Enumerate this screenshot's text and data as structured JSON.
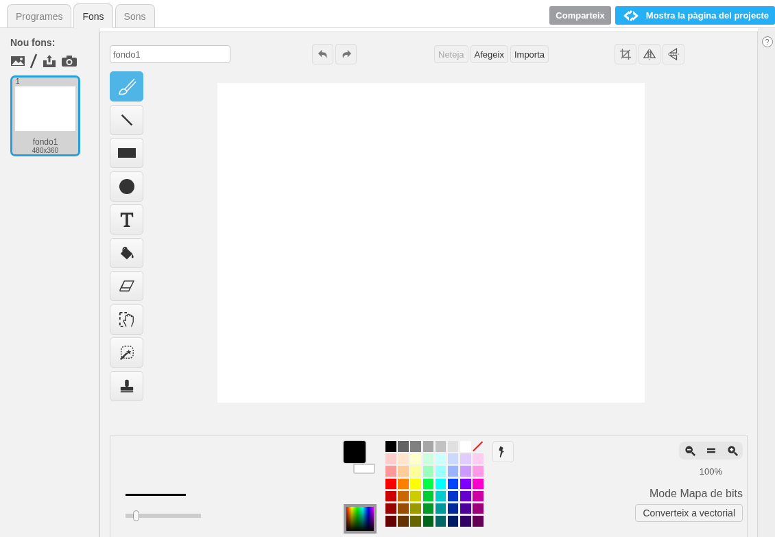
{
  "tabs": [
    {
      "label": "Programes",
      "selected": false
    },
    {
      "label": "Fons",
      "selected": true
    },
    {
      "label": "Sons",
      "selected": false
    }
  ],
  "header_buttons": [
    {
      "label": "Comparteix",
      "kind": "plain"
    },
    {
      "label": "Mostra la pàgina del projecte",
      "kind": "project"
    }
  ],
  "sidebar": {
    "title": "Nou fons:",
    "new_actions": [
      {
        "kind": "library"
      },
      {
        "kind": "paint"
      },
      {
        "kind": "upload"
      },
      {
        "kind": "camera"
      }
    ],
    "backdrops": [
      {
        "index": "1",
        "name": "fondo1",
        "size": "480x360",
        "selected": true
      }
    ]
  },
  "editor": {
    "name_value": "fondo1",
    "history": [
      {
        "kind": "undo"
      },
      {
        "kind": "redo"
      }
    ],
    "actions": [
      {
        "label": "Neteja",
        "disabled": true
      },
      {
        "label": "Afegeix",
        "disabled": false
      },
      {
        "label": "Importa",
        "disabled": false
      }
    ],
    "transforms": [
      {
        "kind": "crop"
      },
      {
        "kind": "flip-h"
      },
      {
        "kind": "flip-v"
      }
    ],
    "tools": [
      {
        "kind": "brush",
        "selected": true
      },
      {
        "kind": "line",
        "selected": false
      },
      {
        "kind": "rect",
        "selected": false
      },
      {
        "kind": "ellipse",
        "selected": false
      },
      {
        "kind": "text",
        "selected": false
      },
      {
        "kind": "fill",
        "selected": false
      },
      {
        "kind": "eraser",
        "selected": false
      },
      {
        "kind": "select",
        "selected": false
      },
      {
        "kind": "magic",
        "selected": false
      },
      {
        "kind": "stamp",
        "selected": false
      }
    ],
    "stroke": {
      "level": 0.1
    },
    "current_colors": [
      {
        "kind": "primary",
        "color": "#000000"
      },
      {
        "kind": "secondary",
        "color": "#ffffff"
      }
    ],
    "palette": [
      {
        "color": "#000000"
      },
      {
        "color": "#636363"
      },
      {
        "color": "#808080"
      },
      {
        "color": "#a6a6a6"
      },
      {
        "color": "#c2c2c2"
      },
      {
        "color": "#e0e0e0"
      },
      {
        "color": "#ffffff"
      },
      {
        "kind": "none"
      },
      {
        "color": "#ffcccc"
      },
      {
        "color": "#ffe5cc"
      },
      {
        "color": "#ffffcc"
      },
      {
        "color": "#ccffdd"
      },
      {
        "color": "#ccffff"
      },
      {
        "color": "#ccd9ff"
      },
      {
        "color": "#e0ccff"
      },
      {
        "color": "#ffccf2"
      },
      {
        "color": "#ff9999"
      },
      {
        "color": "#ffcc99"
      },
      {
        "color": "#ffff99"
      },
      {
        "color": "#99ffbb"
      },
      {
        "color": "#99ffff"
      },
      {
        "color": "#99b3ff"
      },
      {
        "color": "#cc99ff"
      },
      {
        "color": "#ff99e6"
      },
      {
        "color": "#ff0000"
      },
      {
        "color": "#ff8000"
      },
      {
        "color": "#ffff00"
      },
      {
        "color": "#00ff44"
      },
      {
        "color": "#00ffff"
      },
      {
        "color": "#0044ff"
      },
      {
        "color": "#8000ff"
      },
      {
        "color": "#ff00cc"
      },
      {
        "color": "#cc0000"
      },
      {
        "color": "#cc6600"
      },
      {
        "color": "#cccc00"
      },
      {
        "color": "#00cc36"
      },
      {
        "color": "#00cccc"
      },
      {
        "color": "#0036cc"
      },
      {
        "color": "#6600cc"
      },
      {
        "color": "#cc00a3"
      },
      {
        "color": "#990000"
      },
      {
        "color": "#994d00"
      },
      {
        "color": "#999900"
      },
      {
        "color": "#009929"
      },
      {
        "color": "#009999"
      },
      {
        "color": "#002999"
      },
      {
        "color": "#4d0099"
      },
      {
        "color": "#99007a"
      },
      {
        "color": "#660000"
      },
      {
        "color": "#663300"
      },
      {
        "color": "#666600"
      },
      {
        "color": "#00661b"
      },
      {
        "color": "#006666"
      },
      {
        "color": "#001b66"
      },
      {
        "color": "#330066"
      },
      {
        "color": "#660052"
      }
    ],
    "zoom": [
      {
        "kind": "out"
      },
      {
        "kind": "reset"
      },
      {
        "kind": "in"
      }
    ],
    "zoom_level": "100%",
    "mode": "Mode Mapa de bits",
    "convert_button": "Converteix a vectorial"
  },
  "help": {
    "label": "?"
  }
}
